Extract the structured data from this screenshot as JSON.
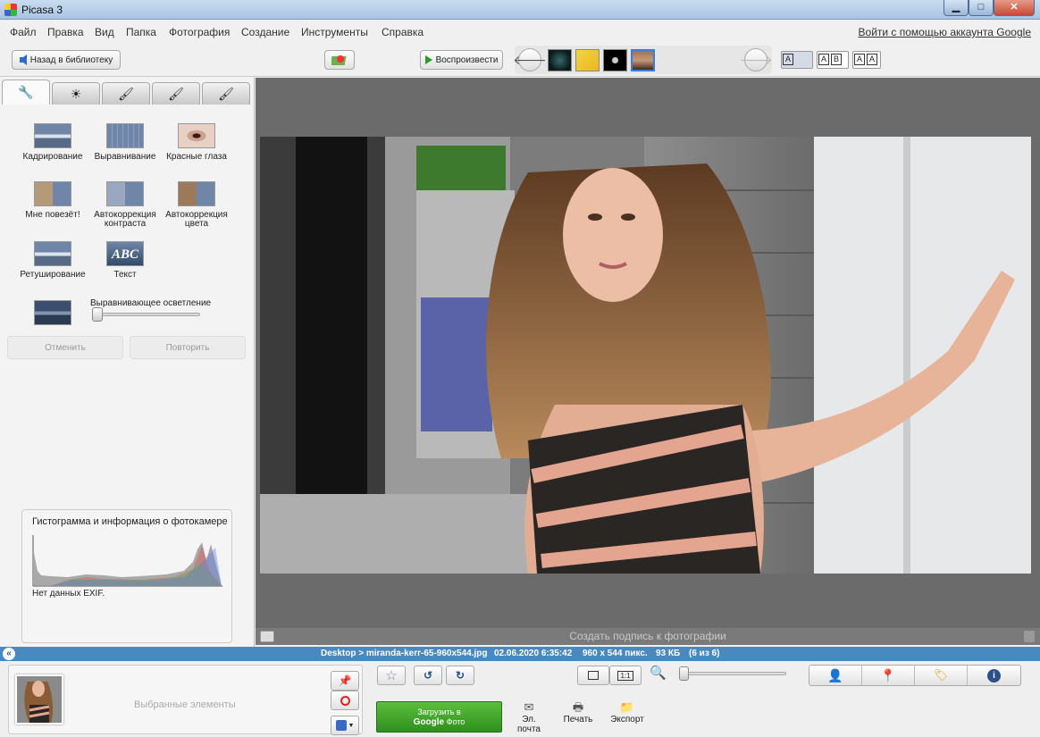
{
  "window": {
    "title": "Picasa 3",
    "min_glyph": "▁",
    "max_glyph": "□",
    "close_glyph": "✕"
  },
  "menu": {
    "items": [
      "Файл",
      "Правка",
      "Вид",
      "Папка",
      "Фотография",
      "Создание",
      "Инструменты",
      "Справка"
    ],
    "signin": "Войти с помощью аккаунта Google"
  },
  "toolbar": {
    "back_label": "Назад в библиотеку",
    "play_label": "Воспроизвести",
    "prev_glyph": "🡐",
    "next_glyph": "🡒",
    "layout_a": "A",
    "layout_ab_1": "A",
    "layout_ab_2": "B",
    "layout_aa_1": "A",
    "layout_aa_2": "A"
  },
  "edit_panel": {
    "tabs": [
      "basic-fixes",
      "tuning",
      "effects-1",
      "effects-2",
      "effects-3"
    ],
    "tools": {
      "crop": "Кадрирование",
      "straighten": "Выравнивание",
      "redeye": "Красные глаза",
      "lucky": "Мне повезёт!",
      "autocontrast_1": "Автокоррекция",
      "autocontrast_2": "контраста",
      "autocolor_1": "Автокоррекция",
      "autocolor_2": "цвета",
      "retouch": "Ретуширование",
      "text": "Текст",
      "text_icon": "ABC"
    },
    "fill_light_label": "Выравнивающее осветление",
    "fill_light_value": 0,
    "undo_label": "Отменить",
    "redo_label": "Повторить",
    "histogram_title": "Гистограмма и информация о фотокамере",
    "exif_text": "Нет данных EXIF."
  },
  "viewer": {
    "caption_placeholder": "Создать подпись к фотографии"
  },
  "status": {
    "path": "Desktop > miranda-kerr-65-960x544.jpg",
    "date": "02.06.2020 6:35:42",
    "dimensions": "960 x 544 пикс.",
    "size": "93 КБ",
    "position": "(6 из 6)",
    "collapse_glyph": "«"
  },
  "tray": {
    "selected_label": "Выбранные элементы",
    "ratio_label": "1:1",
    "upload_line1": "Загрузить в",
    "upload_google": "Google",
    "upload_photo": "Фото",
    "email_label": "Эл. почта",
    "print_label": "Печать",
    "export_label": "Экспорт"
  },
  "colors": {
    "status_bar": "#4a88c0",
    "upload_green": "#3ea42a",
    "accent_blue": "#3a7de0"
  }
}
